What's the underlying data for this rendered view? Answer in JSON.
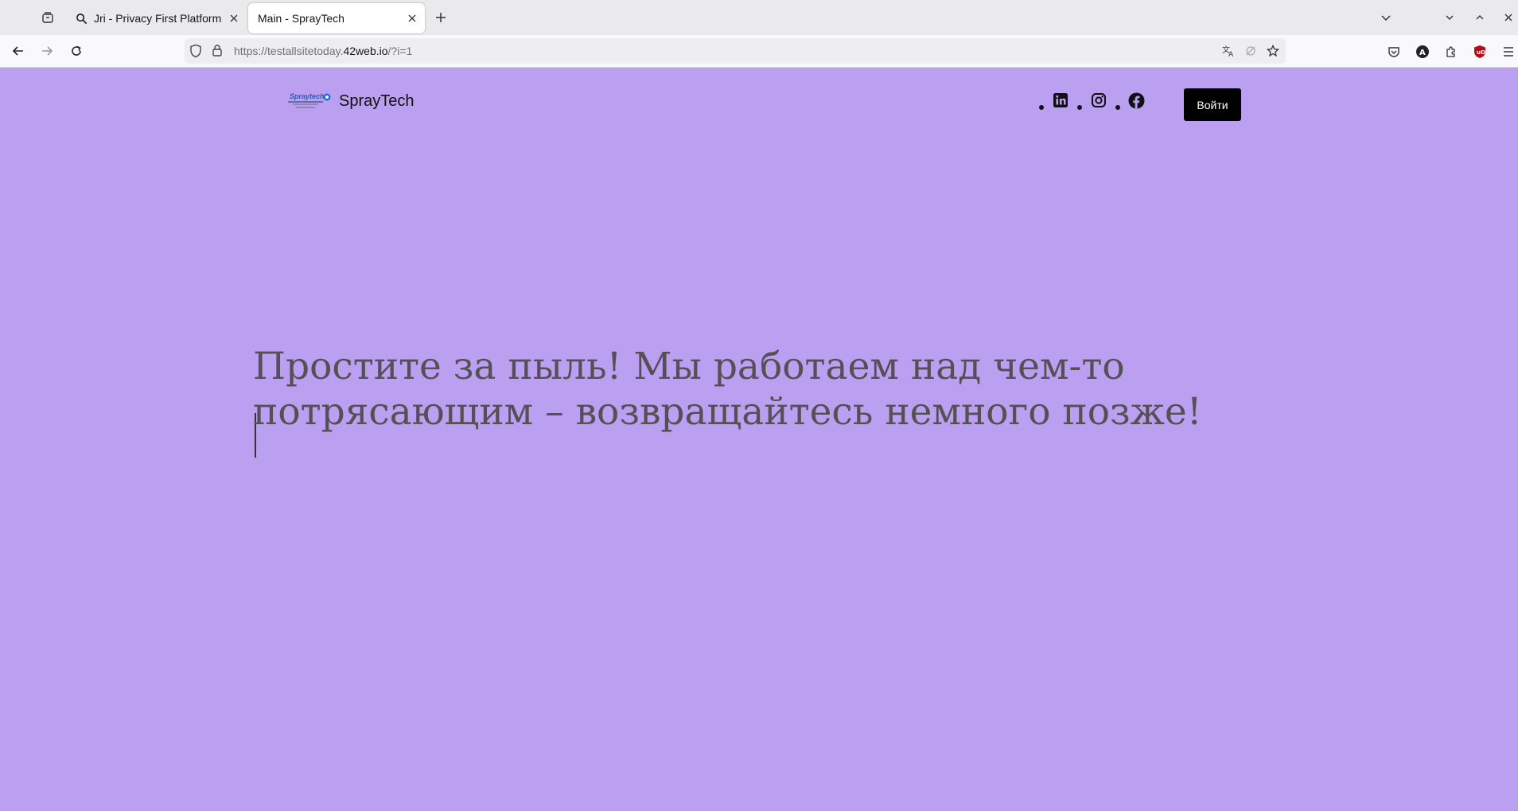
{
  "browser": {
    "tabs": [
      {
        "title": "Jri - Privacy First Platform",
        "active": false,
        "icon": "search-icon"
      },
      {
        "title": "Main - SprayTech",
        "active": true
      }
    ],
    "url": {
      "prefix": "https://testallsitetoday.",
      "domain": "42web.io",
      "suffix": "/?i=1"
    }
  },
  "site": {
    "logo": {
      "brand_text": "Spraytech"
    },
    "title": "SprayTech",
    "social_icons": [
      "linkedin-icon",
      "instagram-icon",
      "facebook-icon"
    ],
    "login_label": "Войти"
  },
  "main": {
    "message": "Простите за пыль! Мы работаем над чем-то потрясающим – возвращайтесь немного позже!"
  },
  "colors": {
    "page_background": "#bb9ff0",
    "button_background": "#000000",
    "message_text": "#555055"
  }
}
